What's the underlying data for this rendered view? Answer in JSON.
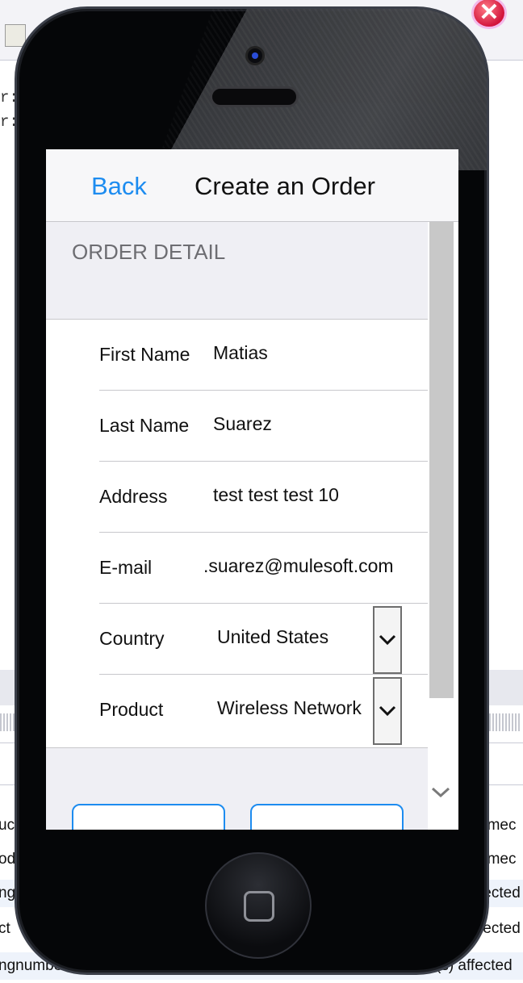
{
  "background": {
    "code_lines": [
      "r:",
      "r:"
    ],
    "rows": [
      {
        "left": "uc",
        "right": "umec"
      },
      {
        "left": "od",
        "right": "umec"
      },
      {
        "left": "ng",
        "right": "fected"
      },
      {
        "left": "ct",
        "right": "fected"
      },
      {
        "left": "ngnumbe",
        "right": "(s) affected"
      }
    ]
  },
  "close_button": {
    "icon": "close-icon"
  },
  "app": {
    "nav": {
      "back_label": "Back",
      "title": "Create an Order"
    },
    "section_title": "ORDER DETAIL",
    "fields": [
      {
        "label": "First Name",
        "value": "Matias"
      },
      {
        "label": "Last Name",
        "value": "Suarez"
      },
      {
        "label": "Address",
        "value": "test test test 10"
      },
      {
        "label": "E-mail",
        "value": ".suarez@mulesoft.com"
      },
      {
        "label": "Country",
        "value": "United States"
      },
      {
        "label": "Product",
        "value": "Wireless Network"
      }
    ],
    "scroll_indicator_icon": "chevron-down-icon",
    "accent_color": "#1d8cf0"
  }
}
